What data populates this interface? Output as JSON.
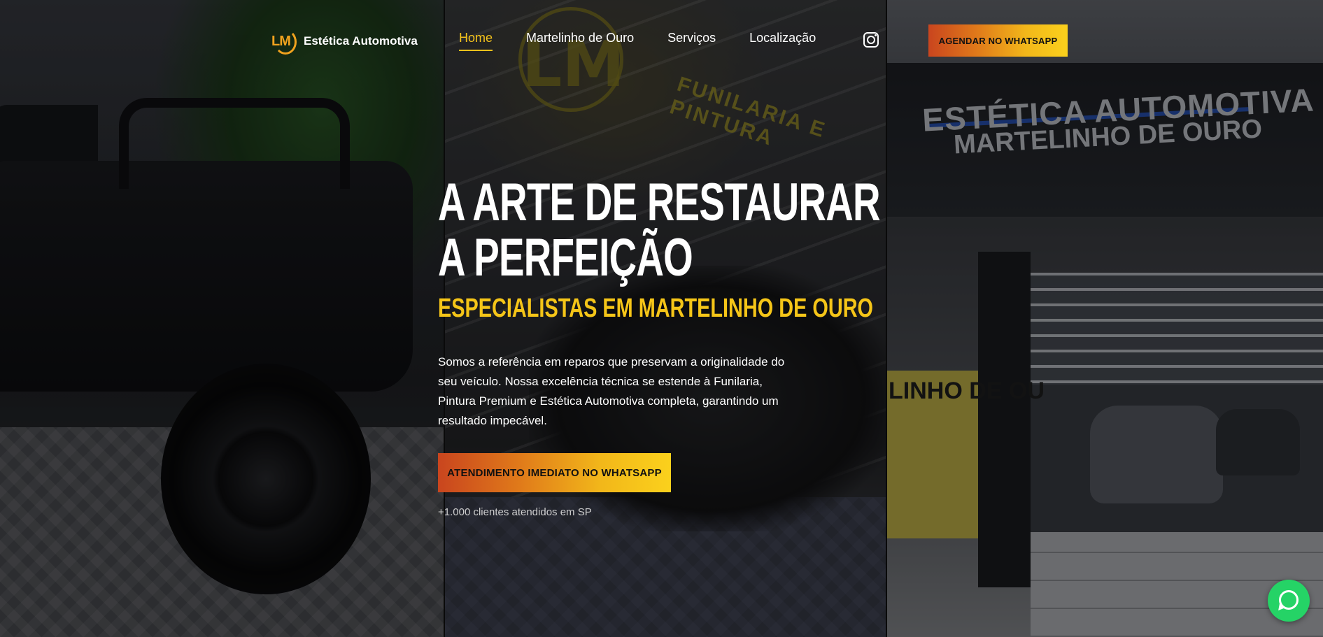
{
  "brand": {
    "logo_monogram": "LM",
    "name": "Estética Automotiva",
    "accent_color": "#f0a21e"
  },
  "nav": {
    "items": [
      {
        "label": "Home",
        "active": true
      },
      {
        "label": "Martelinho de Ouro",
        "active": false
      },
      {
        "label": "Serviços",
        "active": false
      },
      {
        "label": "Localização",
        "active": false
      }
    ],
    "instagram_icon": "instagram-icon",
    "cta_label": "AGENDAR NO WHATSAPP"
  },
  "hero": {
    "title": "A ARTE DE RESTAURAR A PERFEIÇÃO",
    "subtitle": "ESPECIALISTAS EM MARTELINHO DE OURO",
    "description": "Somos a referência em reparos que preservam a originalidade do seu veículo. Nossa excelência técnica se estende à Funilaria, Pintura Premium e Estética Automotiva completa, garantindo um resultado impecável.",
    "cta_label": "ATENDIMENTO IMEDIATO NO WHATSAPP",
    "social_proof": "+1.000 clientes atendidos em SP"
  },
  "background": {
    "wall_monogram": "LM",
    "wall_text": "FUNILARIA E PINTURA",
    "storefront_sign_line1": "ESTÉTICA AUTOMOTIVA",
    "storefront_sign_line2": "MARTELINHO DE OURO",
    "storefront_banner": "LINHO DE OU"
  },
  "colors": {
    "accent_yellow": "#f5c518",
    "cta_gradient_start": "#c9451e",
    "cta_gradient_end": "#fbd11c",
    "whatsapp_green": "#25d366"
  },
  "floating": {
    "whatsapp_icon": "whatsapp-icon"
  }
}
